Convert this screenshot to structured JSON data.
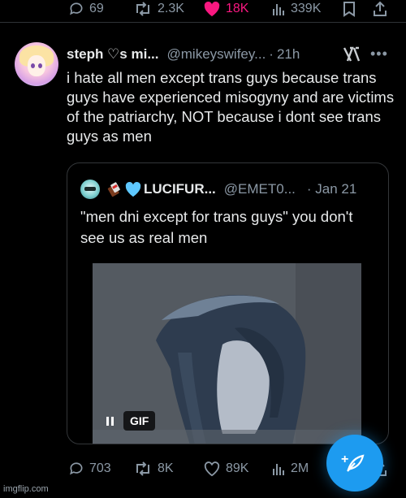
{
  "top_actions": {
    "replies": "69",
    "reposts": "2.3K",
    "likes": "18K",
    "views": "339K"
  },
  "tweet": {
    "display_name": "steph ♡s mi...",
    "handle": "@mikeyswifey...",
    "separator": "·",
    "time": "21h",
    "text": "i hate all men except trans guys because trans guys have experienced misogyny and are victims of the patriarchy, NOT because i dont see trans guys as men"
  },
  "quote": {
    "display_name": "LUCIFUR...",
    "handle": "@EMET0...",
    "date": "· Jan 21",
    "text": "\"men dni except for trans guys\" you don't see us as real men",
    "gif_badge": "GIF"
  },
  "bottom_actions": {
    "replies": "703",
    "reposts": "8K",
    "likes": "89K",
    "views": "2M"
  },
  "colors": {
    "background": "#000000",
    "text": "#e7e9ea",
    "muted": "#8b98a5",
    "like": "#f91880",
    "accent": "#1d9bf0"
  },
  "watermark": "imgflip.com"
}
